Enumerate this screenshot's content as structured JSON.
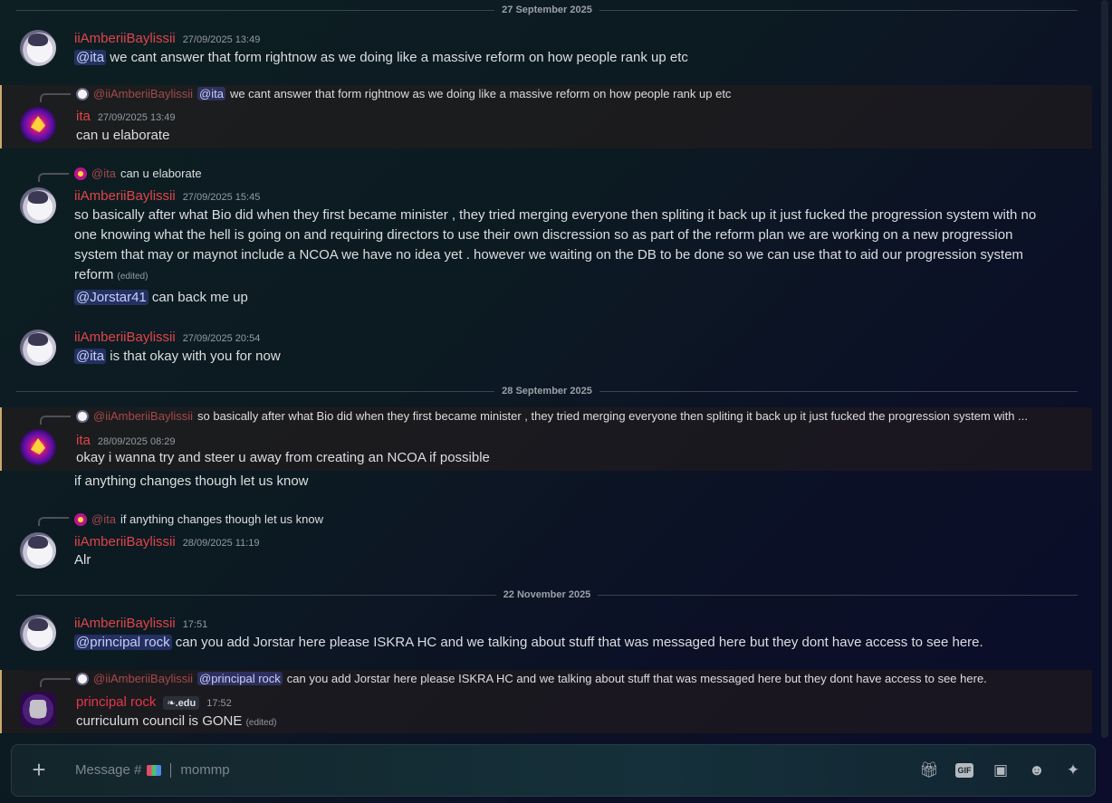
{
  "dividers": [
    "27 September 2025",
    "28 September 2025",
    "22 November 2025"
  ],
  "m1": {
    "user": "iiAmberiiBaylissii",
    "time": "27/09/2025 13:49",
    "mention": "@ita",
    "text": " we cant answer that form rightnow as we doing like a massive reform on how people rank up etc"
  },
  "m2": {
    "reply_user": "@iiAmberiiBaylissii",
    "reply_mention": "@ita",
    "reply_text": "we cant answer that form rightnow as we doing like a massive reform on how people rank up etc",
    "user": "ita",
    "time": "27/09/2025 13:49",
    "text": "can u elaborate"
  },
  "m3": {
    "reply_user": "@ita",
    "reply_text": "can u elaborate",
    "user": "iiAmberiiBaylissii",
    "time": "27/09/2025 15:45",
    "text": "so basically after what Bio did when they first became minister , they tried merging everyone then spliting it back up it just fucked the progression system with no one knowing what the hell is going on and requiring directors to use their own discression so as part of the reform plan we are working on a new progression system that may or maynot include a NCOA we have no idea yet . however we waiting on the DB to be done so we can use that to aid our progression system reform",
    "edited": "(edited)",
    "mention2": "@Jorstar41",
    "text2": " can back me up"
  },
  "m4": {
    "user": "iiAmberiiBaylissii",
    "time": "27/09/2025 20:54",
    "mention": "@ita",
    "text": " is that okay with you for now"
  },
  "m5": {
    "reply_user": "@iiAmberiiBaylissii",
    "reply_text": "so basically after what Bio did when they first became minister , they tried merging everyone then spliting it back up it just fucked the progression system with ...",
    "user": "ita",
    "time": "28/09/2025 08:29",
    "text": "okay i wanna try and steer u away from creating an NCOA if possible",
    "text2": "if anything changes though let us know"
  },
  "m6": {
    "reply_user": "@ita",
    "reply_text": "if anything changes though let us know",
    "user": "iiAmberiiBaylissii",
    "time": "28/09/2025 11:19",
    "text": "Alr"
  },
  "m7": {
    "user": "iiAmberiiBaylissii",
    "time": "17:51",
    "mention": "@principal rock",
    "text": " can you add Jorstar here please ISKRA HC and we talking about stuff that was messaged here but they dont have access to see here."
  },
  "m8": {
    "reply_user": "@iiAmberiiBaylissii",
    "reply_mention": "@principal rock",
    "reply_text": "can you add Jorstar here please ISKRA HC and we talking about stuff that was messaged here but they dont have access to see here.",
    "user": "principal rock",
    "tag": ".edu",
    "time": "17:52",
    "text": "curriculum council is GONE",
    "edited": "(edited)"
  },
  "composer": {
    "placeholder": "Message #",
    "channel": "mommp"
  },
  "colors": {
    "username": "#e0454a",
    "mention_bg": "#3c4380",
    "highlight_border": "#c9a96e"
  }
}
